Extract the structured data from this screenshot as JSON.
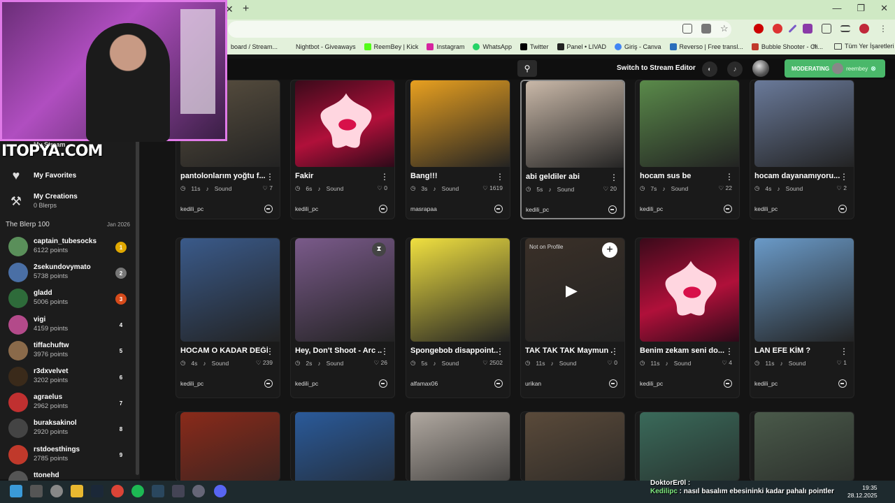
{
  "browser": {
    "bookmarks": [
      {
        "label": "board / Stream...",
        "color": "#666"
      },
      {
        "label": "Nightbot - Giveaways",
        "color": "#333"
      },
      {
        "label": "ReemBey | Kick",
        "color": "#53fc18"
      },
      {
        "label": "Instagram",
        "color": "#d6249f"
      },
      {
        "label": "WhatsApp",
        "color": "#25d366"
      },
      {
        "label": "Twitter",
        "color": "#000000"
      },
      {
        "label": "Panel • LIVAD",
        "color": "#222"
      },
      {
        "label": "Giriş - Canva",
        "color": "#00c4cc"
      },
      {
        "label": "Reverso | Free transl...",
        "color": "#2a6ebb"
      },
      {
        "label": "Bubble Shooter - Cli...",
        "color": "#c0392b"
      }
    ],
    "more": "»",
    "all_bookmarks": "Tüm Yer İşaretleri"
  },
  "header": {
    "switch_label": "Switch to Stream Editor",
    "moderating_label": "MODERATING",
    "moderating_user": "reembey"
  },
  "sidebar": {
    "my_stream": "My Stream",
    "favorites": "My Favorites",
    "creations": "My Creations",
    "creations_sub": "0 Blerps",
    "blerp100_title": "The Blerp 100",
    "blerp100_date": "Jan 2026"
  },
  "leaderboard": [
    {
      "name": "captain_tubesocks",
      "points": "6122 points",
      "rank": "1",
      "rank_color": "#e0a800",
      "avatar": "#5a8f5a"
    },
    {
      "name": "2sekundovymato",
      "points": "5738 points",
      "rank": "2",
      "rank_color": "#777",
      "avatar": "#4a6fa5"
    },
    {
      "name": "gladd",
      "points": "5006 points",
      "rank": "3",
      "rank_color": "#d64a1a",
      "avatar": "#2e6b3a"
    },
    {
      "name": "vigi",
      "points": "4159 points",
      "rank": "4",
      "rank_color": "transparent",
      "avatar": "#b34a8a"
    },
    {
      "name": "tiffachuftw",
      "points": "3976 points",
      "rank": "5",
      "rank_color": "transparent",
      "avatar": "#8a6a4a"
    },
    {
      "name": "r3dxvelvet",
      "points": "3202 points",
      "rank": "6",
      "rank_color": "transparent",
      "avatar": "#3a2a1a"
    },
    {
      "name": "agraelus",
      "points": "2962 points",
      "rank": "7",
      "rank_color": "transparent",
      "avatar": "#c03030"
    },
    {
      "name": "buraksakinol",
      "points": "2920 points",
      "rank": "8",
      "rank_color": "transparent",
      "avatar": "#444"
    },
    {
      "name": "rstdoesthings",
      "points": "2785 points",
      "rank": "9",
      "rank_color": "transparent",
      "avatar": "#c0392b"
    },
    {
      "name": "ttonehd",
      "points": "",
      "rank": "",
      "rank_color": "transparent",
      "avatar": "#555"
    }
  ],
  "cards": [
    {
      "title": "pantolonlarım yoğtu f...",
      "duration": "11s",
      "type": "Sound",
      "likes": "7",
      "user": "kedili_pc",
      "img": "#5a5040"
    },
    {
      "title": "Fakir",
      "duration": "6s",
      "type": "Sound",
      "likes": "0",
      "user": "kedili_pc",
      "img": "star"
    },
    {
      "title": "Bang!!!",
      "duration": "3s",
      "type": "Sound",
      "likes": "1619",
      "user": "masrapaa",
      "img": "#e8a020"
    },
    {
      "title": "abi geldiler abi",
      "duration": "5s",
      "type": "Sound",
      "likes": "20",
      "user": "kedili_pc",
      "img": "#c9b8a8"
    },
    {
      "title": "hocam sus be",
      "duration": "7s",
      "type": "Sound",
      "likes": "22",
      "user": "kedili_pc",
      "img": "#5a8a4a"
    },
    {
      "title": "hocam dayanamıyoru...",
      "duration": "4s",
      "type": "Sound",
      "likes": "2",
      "user": "kedili_pc",
      "img": "#6a7a9a"
    },
    {
      "title": "HOCAM O KADAR DEĞİL",
      "duration": "4s",
      "type": "Sound",
      "likes": "239",
      "user": "kedili_pc",
      "img": "#3a5a8a"
    },
    {
      "title": "Hey, Don't Shoot - Arc ...",
      "duration": "2s",
      "type": "Sound",
      "likes": "26",
      "user": "kedili_pc",
      "img": "#7a5a8a"
    },
    {
      "title": "Spongebob disappoint...",
      "duration": "5s",
      "type": "Sound",
      "likes": "2502",
      "user": "alfamax06",
      "img": "#f0e040"
    },
    {
      "title": "TAK TAK TAK Maymun ...",
      "duration": "11s",
      "type": "Sound",
      "likes": "0",
      "user": "urikan",
      "img": "#3a3028"
    },
    {
      "title": "Benim zekam seni do...",
      "duration": "11s",
      "type": "Sound",
      "likes": "4",
      "user": "kedili_pc",
      "img": "star"
    },
    {
      "title": "LAN EFE KİM ?",
      "duration": "11s",
      "type": "Sound",
      "likes": "1",
      "user": "kedili_pc",
      "img": "#6a9ac8"
    },
    {
      "title": "",
      "duration": "",
      "type": "",
      "likes": "",
      "user": "",
      "img": "#8a2a1a"
    },
    {
      "title": "",
      "duration": "",
      "type": "",
      "likes": "",
      "user": "",
      "img": "#2a5a9a"
    },
    {
      "title": "",
      "duration": "",
      "type": "",
      "likes": "",
      "user": "",
      "img": "#b0a8a0"
    },
    {
      "title": "",
      "duration": "",
      "type": "",
      "likes": "",
      "user": "",
      "img": "#5a4a3a"
    },
    {
      "title": "",
      "duration": "",
      "type": "",
      "likes": "",
      "user": "",
      "img": "#3a6a5a"
    },
    {
      "title": "",
      "duration": "",
      "type": "",
      "likes": "",
      "user": "",
      "img": "#4a5a4a"
    }
  ],
  "not_on_profile": "Not on Profile",
  "stream_overlay": {
    "logo": "ITOPYA.COM"
  },
  "chat": [
    {
      "user": "DoktorEr0l",
      "message": ""
    },
    {
      "user": "Kedilipc",
      "message": "nasıl basalım ebesininki kadar pahalı pointler"
    }
  ],
  "clock": {
    "time": "19:35",
    "date": "28.12.2025"
  },
  "colors": {
    "accent": "#4ab86a",
    "card_bg": "#1a1a1a",
    "star": "#ff4a7a"
  }
}
